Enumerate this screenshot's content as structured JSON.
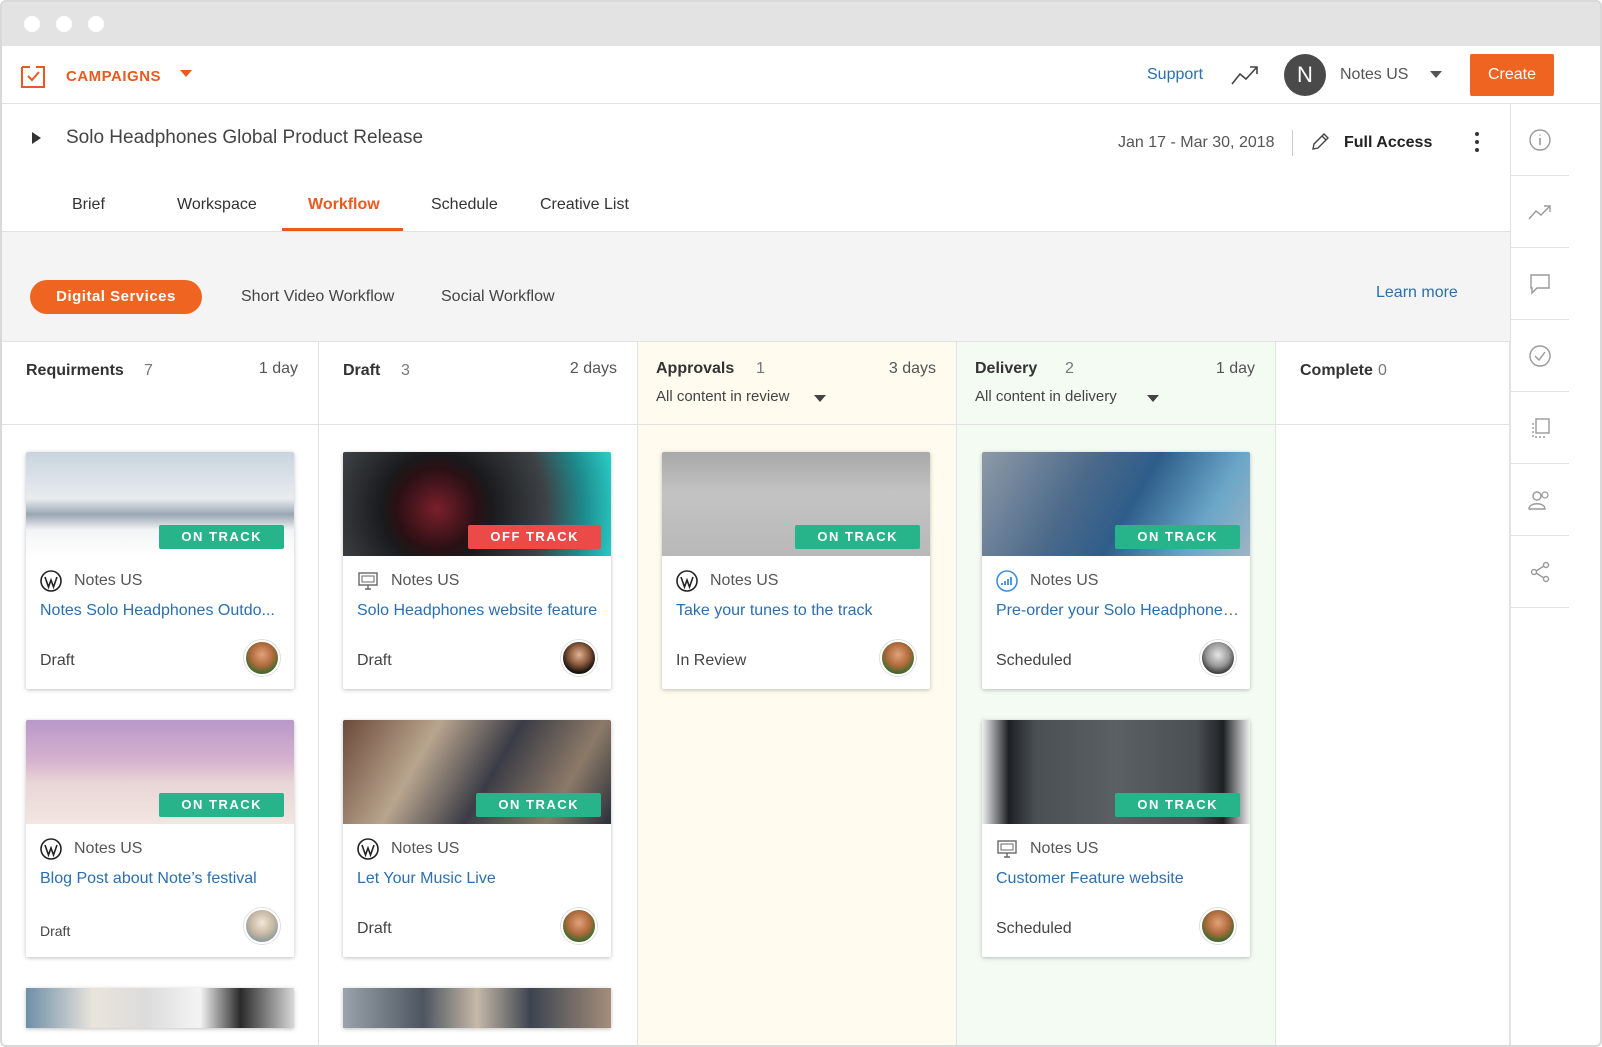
{
  "app": {
    "brand": "CAMPAIGNS",
    "support": "Support",
    "account": "Notes US",
    "avatar_letter": "N",
    "create": "Create",
    "accent": "#ef6421",
    "link_color": "#2a6fb0",
    "on_track_color": "#27b48b",
    "off_track_color": "#ec4a48"
  },
  "campaign": {
    "title": "Solo Headphones Global Product Release",
    "dates": "Jan 17 - Mar 30, 2018",
    "access": "Full Access"
  },
  "tabs": [
    {
      "label": "Brief"
    },
    {
      "label": "Workspace"
    },
    {
      "label": "Workflow",
      "active": true
    },
    {
      "label": "Schedule"
    },
    {
      "label": "Creative List"
    }
  ],
  "workflows": {
    "active": "Digital Services",
    "others": [
      "Short Video Workflow",
      "Social Workflow"
    ],
    "learn_more": "Learn more"
  },
  "sidebar_icons": [
    "info-icon",
    "trend-icon",
    "comment-icon",
    "check-circle-icon",
    "copy-icon",
    "people-icon",
    "share-icon"
  ],
  "columns": [
    {
      "name": "Requirments",
      "count": "7",
      "duration": "1 day",
      "filter": "",
      "bg": "#ffffff",
      "cards": [
        {
          "badge": "ON TRACK",
          "channel": "Notes US",
          "channel_icon": "wordpress-icon",
          "title": "Notes Solo Headphones Outdo...",
          "status": "Draft"
        },
        {
          "badge": "ON TRACK",
          "channel": "Notes US",
          "channel_icon": "wordpress-icon",
          "title": "Blog Post about Note’s festival",
          "status": "Draft"
        }
      ]
    },
    {
      "name": "Draft",
      "count": "3",
      "duration": "2 days",
      "filter": "",
      "bg": "#ffffff",
      "cards": [
        {
          "badge": "OFF TRACK",
          "channel": "Notes US",
          "channel_icon": "monitor-icon",
          "title": "Solo Headphones website feature",
          "status": "Draft"
        },
        {
          "badge": "ON TRACK",
          "channel": "Notes US",
          "channel_icon": "wordpress-icon",
          "title": "Let Your Music Live",
          "status": "Draft"
        }
      ]
    },
    {
      "name": "Approvals",
      "count": "1",
      "duration": "3 days",
      "filter": "All content in review",
      "bg": "#fffbee",
      "cards": [
        {
          "badge": "ON TRACK",
          "channel": "Notes US",
          "channel_icon": "wordpress-icon",
          "title": "Take your tunes to the track",
          "status": "In Review"
        }
      ]
    },
    {
      "name": "Delivery",
      "count": "2",
      "duration": "1 day",
      "filter": "All content in delivery",
      "bg": "#f3fbf3",
      "cards": [
        {
          "badge": "ON TRACK",
          "channel": "Notes US",
          "channel_icon": "signal-icon",
          "title": "Pre-order your Solo Headphones...",
          "status": "Scheduled"
        },
        {
          "badge": "ON TRACK",
          "channel": "Notes US",
          "channel_icon": "monitor-icon",
          "title": "Customer Feature website",
          "status": "Scheduled"
        }
      ]
    },
    {
      "name": "Complete",
      "count": "0",
      "duration": "",
      "filter": "",
      "bg": "#ffffff",
      "cards": []
    }
  ]
}
